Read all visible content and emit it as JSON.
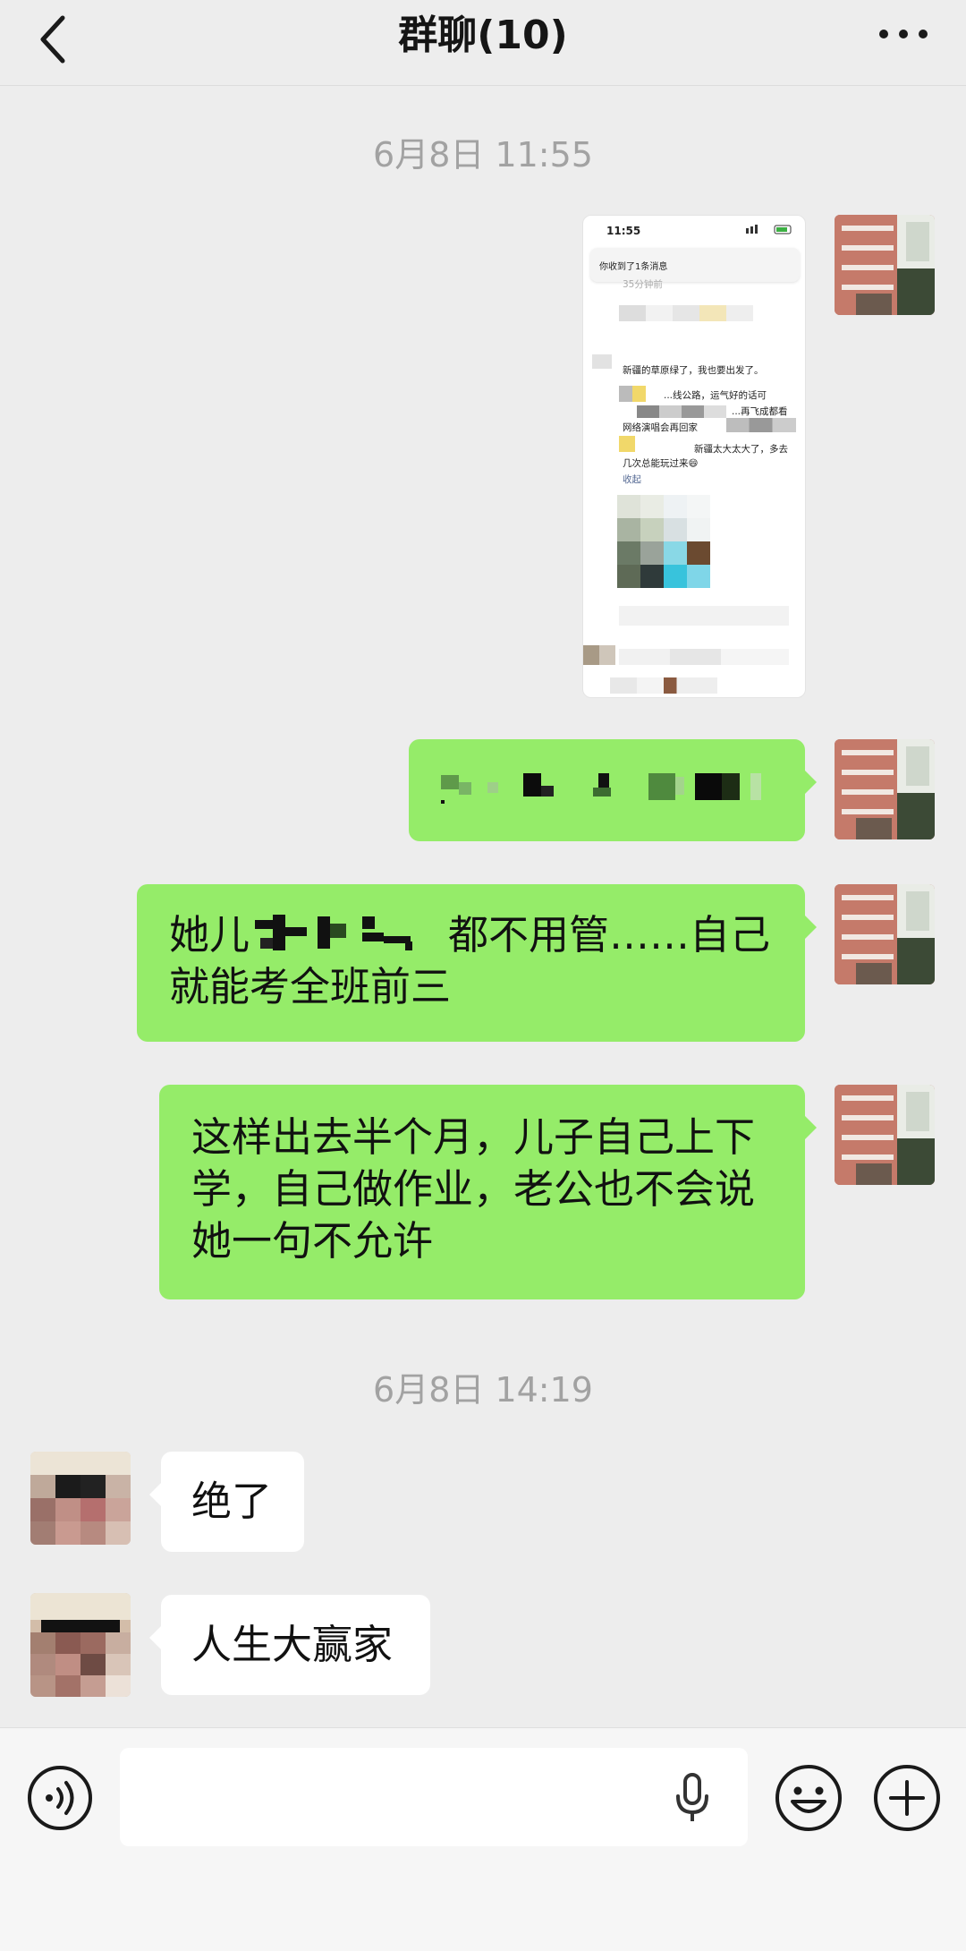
{
  "header": {
    "back_icon": "chevron-left-icon",
    "title": "群聊(10)",
    "more_icon": "more-dots-icon"
  },
  "messages": {
    "time1": "6月8日 11:55",
    "screenshot": {
      "status_time": "11:55",
      "notification": "你收到了1条消息",
      "line_time": "35分钟前",
      "line1": "新疆的草原绿了，我也要出发了。",
      "line2": "...线公路，运气好的话可",
      "line3": "...再飞成都看",
      "line4": "网络演唱会再回家",
      "line5": "新疆太大太大了，多去",
      "line6": "几次总能玩过来😄",
      "line7": "收起"
    },
    "msg2_prefix": "",
    "msg3_part1": "她儿",
    "msg3_part2": "都不用管……自己",
    "msg3_line2": "就能考全班前三",
    "msg4_line1": "这样出去半个月，儿子自己上下",
    "msg4_line2": "学，自己做作业，老公也不会说",
    "msg4_line3": "她一句不允许",
    "time2": "6月8日 14:19",
    "reply1": "绝了",
    "reply2": "人生大赢家"
  },
  "input_bar": {
    "voice_icon": "voice-mode-icon",
    "mic_icon": "microphone-icon",
    "emoji_icon": "emoji-icon",
    "plus_icon": "plus-icon",
    "input_value": ""
  },
  "colors": {
    "background": "#ededed",
    "outgoing_bubble": "#95ec69",
    "incoming_bubble": "#ffffff",
    "timestamp": "#a2a2a2"
  }
}
